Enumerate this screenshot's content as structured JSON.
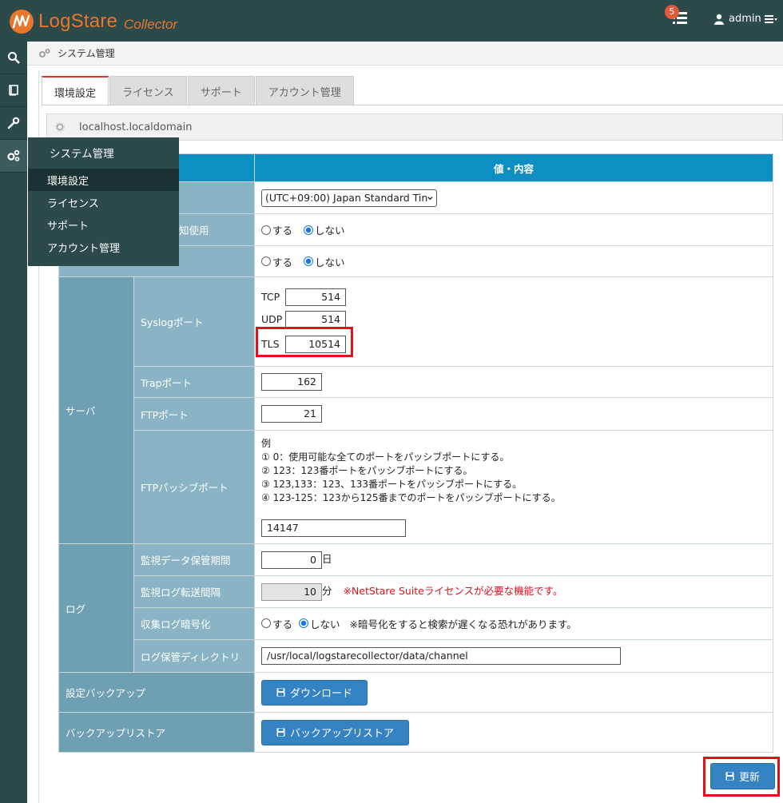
{
  "brand": {
    "name": "LogStare",
    "sub": "Collector"
  },
  "header": {
    "notification_count": "5",
    "user": "admin"
  },
  "breadcrumb": "システム管理",
  "tabs": [
    "環境設定",
    "ライセンス",
    "サポート",
    "アカウント管理"
  ],
  "host": "localhost.localdomain",
  "table": {
    "header_value": "値・内容",
    "timezone": "(UTC+09:00) Japan Standard Tin",
    "row_notify_label": "知使用",
    "radio_yes": "する",
    "radio_no": "しない",
    "server_group": "サーバ",
    "syslog_label": "Syslogポート",
    "tcp_label": "TCP",
    "tcp_value": "514",
    "udp_label": "UDP",
    "udp_value": "514",
    "tls_label": "TLS",
    "tls_value": "10514",
    "trap_label": "Trapポート",
    "trap_value": "162",
    "ftp_label": "FTPポート",
    "ftp_value": "21",
    "ftp_passive_label": "FTPパッシブポート",
    "ftp_passive_examples": [
      "例",
      "① 0：使用可能な全てのポートをパッシブポートにする。",
      "② 123：123番ポートをパッシブポートにする。",
      "③ 123,133：123、133番ポートをパッシブポートにする。",
      "④ 123-125：123から125番までのポートをパッシブポートにする。"
    ],
    "ftp_passive_value": "14147",
    "log_group": "ログ",
    "monitor_retention_label": "監視データ保管期間",
    "monitor_retention_value": "0",
    "day_unit": "日",
    "monitor_transfer_label": "監視ログ転送間隔",
    "monitor_transfer_value": "10",
    "minute_unit": "分",
    "license_warning": "※NetStare Suiteライセンスが必要な機能です。",
    "encrypt_label": "収集ログ暗号化",
    "encrypt_note": "※暗号化をすると検索が遅くなる恐れがあります。",
    "log_dir_label": "ログ保管ディレクトリ",
    "log_dir_value": "/usr/local/logstarecollector/data/channel",
    "backup_label": "設定バックアップ",
    "download_button": "ダウンロード",
    "restore_label": "バックアップリストア",
    "restore_button": "バックアップリストア"
  },
  "update_button": "更新",
  "flyout": {
    "title": "システム管理",
    "items": [
      "環境設定",
      "ライセンス",
      "サポート",
      "アカウント管理"
    ]
  }
}
